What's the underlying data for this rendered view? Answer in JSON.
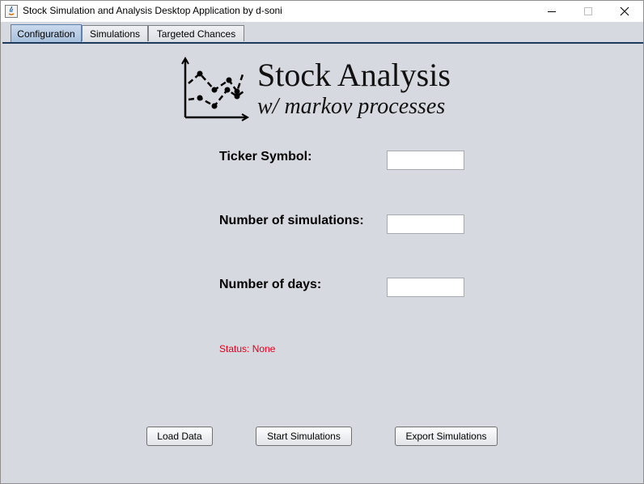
{
  "window": {
    "title": "Stock Simulation and Analysis Desktop Application by d-soni"
  },
  "tabs": [
    {
      "label": "Configuration",
      "active": true
    },
    {
      "label": "Simulations",
      "active": false
    },
    {
      "label": "Targeted Chances",
      "active": false
    }
  ],
  "logo": {
    "title": "Stock Analysis",
    "subtitle": "w/ markov processes"
  },
  "form": {
    "ticker_label": "Ticker Symbol:",
    "ticker_value": "",
    "simulations_label": "Number of simulations:",
    "simulations_value": "",
    "days_label": "Number of days:",
    "days_value": ""
  },
  "status": "Status: None",
  "buttons": {
    "load": "Load Data",
    "start": "Start Simulations",
    "export": "Export Simulations"
  },
  "colors": {
    "status": "#e0001b",
    "active_tab": "#a9c1dd",
    "background": "#d6d9df"
  }
}
